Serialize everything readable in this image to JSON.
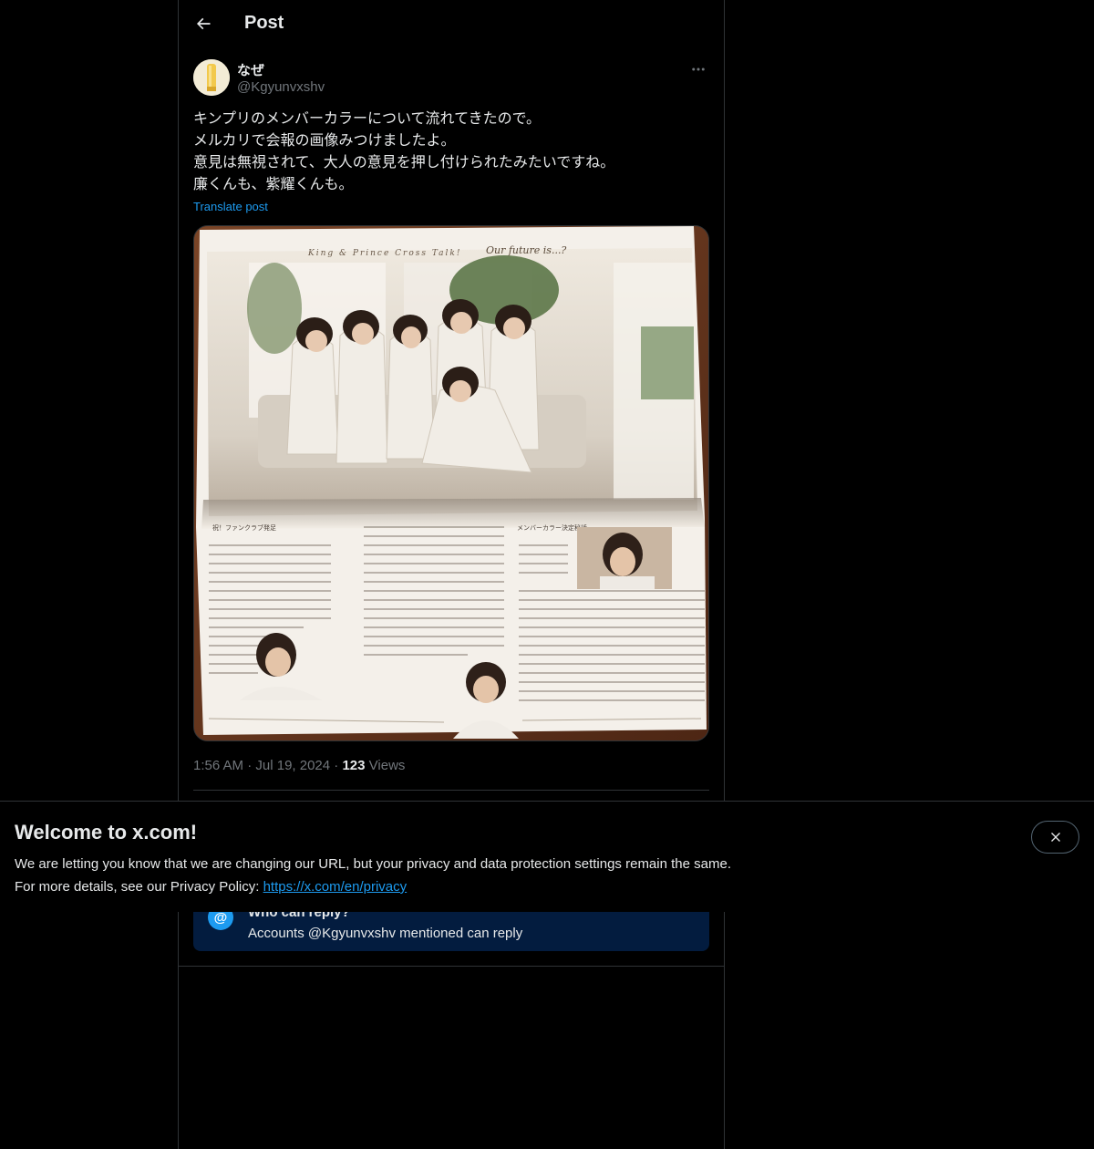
{
  "header": {
    "title": "Post"
  },
  "author": {
    "display_name": "なぜ",
    "handle": "@Kgyunvxshv"
  },
  "tweet": {
    "lines": [
      "キンプリのメンバーカラーについて流れてきたので。",
      "メルカリで会報の画像みつけましたよ。",
      "意見は無視されて、大人の意見を押し付けられたみたいですね。",
      "廉くんも、紫耀くんも。"
    ],
    "translate_label": "Translate post"
  },
  "media": {
    "header_text": "King & Prince Cross Talk!",
    "header_script": "Our future is...?",
    "col1_heading": "祝！ファンクラブ発足",
    "col3_heading": "メンバーカラー決定秘話"
  },
  "meta": {
    "time": "1:56 AM",
    "date": "Jul 19, 2024",
    "views_count": "123",
    "views_label": "Views"
  },
  "reply": {
    "title": "Who can reply?",
    "subtitle": "Accounts @Kgyunvxshv mentioned can reply",
    "icon_glyph": "@"
  },
  "banner": {
    "title": "Welcome to x.com!",
    "line1": "We are letting you know that we are changing our URL, but your privacy and data protection settings remain the same.",
    "line2_prefix": "For more details, see our Privacy Policy: ",
    "link": "https://x.com/en/privacy"
  },
  "colors": {
    "accent": "#1d9bf0",
    "background": "#000000",
    "text": "#e7e9ea",
    "muted": "#71767b",
    "reply_box": "#031c3f"
  }
}
